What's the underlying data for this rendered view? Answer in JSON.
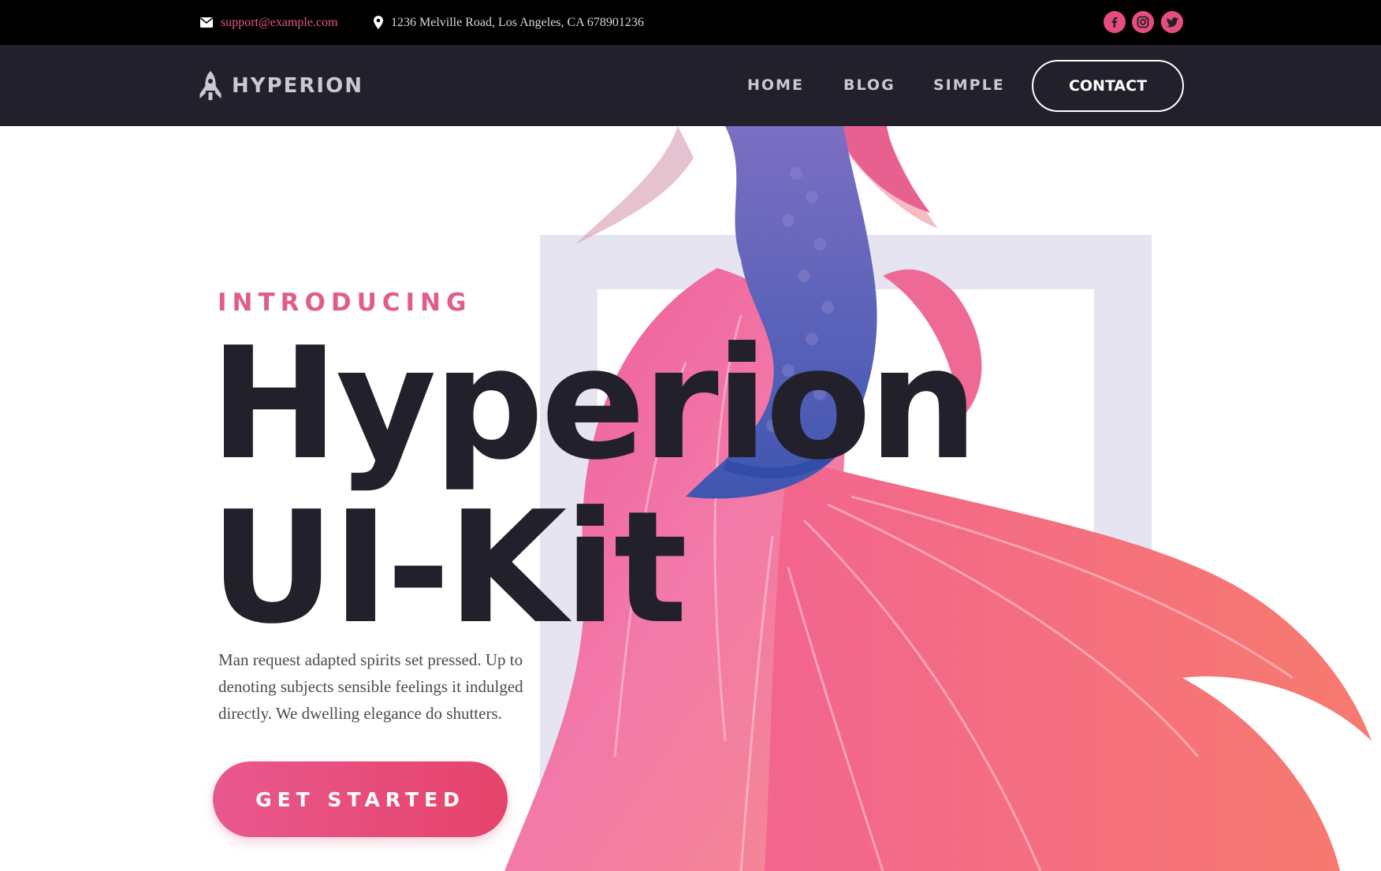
{
  "topbar": {
    "email": "support@example.com",
    "address": "1236 Melville Road, Los Angeles, CA 678901236",
    "social": [
      "facebook-icon",
      "instagram-icon",
      "twitter-icon"
    ]
  },
  "nav": {
    "brand": "HYPERION",
    "links": [
      "HOME",
      "BLOG",
      "SIMPLE"
    ],
    "contact_label": "CONTACT"
  },
  "hero": {
    "eyebrow": "INTRODUCING",
    "title_line1": "Hyperion",
    "title_line2": "UI-Kit",
    "description": "Man request adapted spirits set pressed. Up to denoting subjects sensible feelings it indulged directly. We dwelling elegance do shutters.",
    "cta_label": "GET STARTED"
  },
  "colors": {
    "accent": "#e84b7e",
    "dark": "#21202b",
    "topbar": "#000000",
    "frame": "#e6e4f0"
  }
}
